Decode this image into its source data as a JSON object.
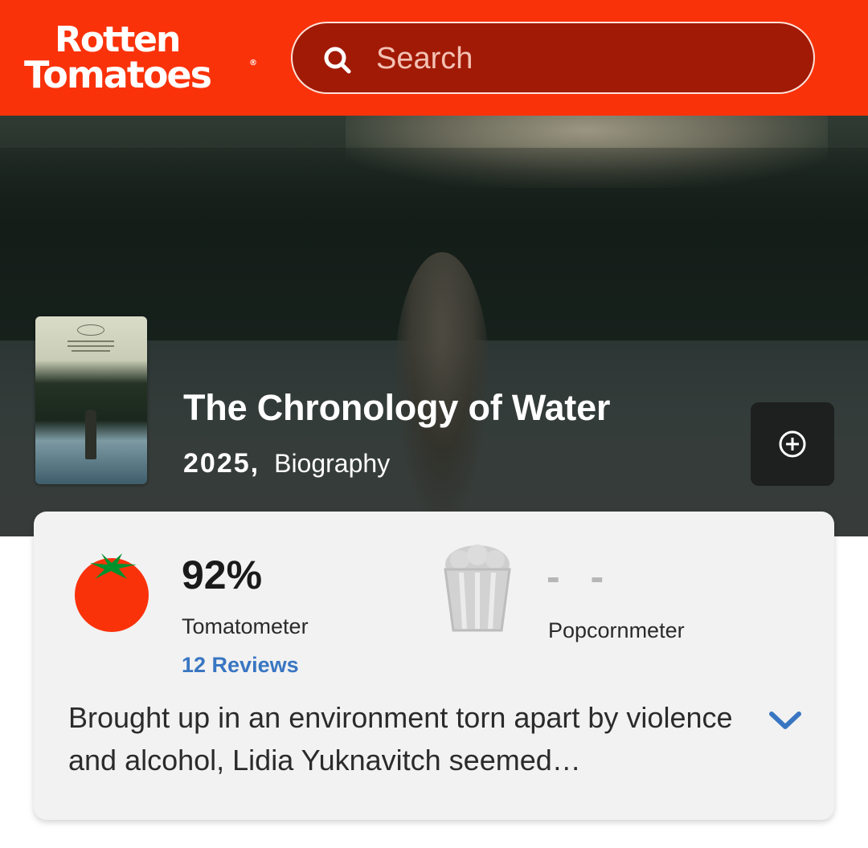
{
  "header": {
    "logo_line1": "Rotten",
    "logo_line2": "Tomatoes",
    "logo_mark": "®",
    "search_placeholder": "Search",
    "search_icon": "search-icon",
    "brand_color": "#fa320a"
  },
  "movie": {
    "title": "The Chronology of Water",
    "year": "2025,",
    "genre": "Biography",
    "poster_icon": "movie-poster",
    "add_icon": "plus-circle-icon"
  },
  "scores": {
    "tomatometer": {
      "value": "92%",
      "label": "Tomatometer",
      "reviews_link": "12 Reviews",
      "icon": "tomato-icon",
      "link_color": "#3976c2"
    },
    "popcornmeter": {
      "value": "- -",
      "label": "Popcornmeter",
      "icon": "popcorn-bucket-icon"
    }
  },
  "synopsis": {
    "text": "Brought up in an environment torn apart by violence and alcohol, Lidia Yuknavitch seemed…",
    "expand_icon": "chevron-down-icon"
  }
}
